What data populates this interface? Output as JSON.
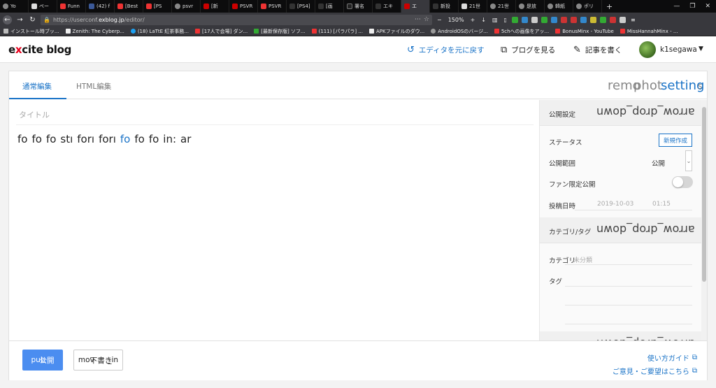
{
  "browser": {
    "tabs": [
      {
        "label": "Yo",
        "fav": "grey"
      },
      {
        "label": "ペー",
        "fav": "white"
      },
      {
        "label": "Funn",
        "fav": ""
      },
      {
        "label": "(42) f",
        "fav": "blue"
      },
      {
        "label": "[Best",
        "fav": ""
      },
      {
        "label": "[PS",
        "fav": ""
      },
      {
        "label": "psvr",
        "fav": "grey"
      },
      {
        "label": "[新",
        "fav": "red2"
      },
      {
        "label": "PSVR",
        "fav": "red2"
      },
      {
        "label": "PSVR",
        "fav": ""
      },
      {
        "label": "[PS4] ",
        "fav": "dark"
      },
      {
        "label": "[画",
        "fav": "dark"
      },
      {
        "label": "署名",
        "fav": "black"
      },
      {
        "label": "エキ",
        "fav": "dark"
      },
      {
        "label": "エ",
        "fav": "red2",
        "active": true
      },
      {
        "label": "新投",
        "fav": "dark"
      },
      {
        "label": "21世",
        "fav": "white"
      },
      {
        "label": "21世",
        "fav": "grey"
      },
      {
        "label": "是放",
        "fav": "grey"
      },
      {
        "label": "韓紙",
        "fav": "grey"
      },
      {
        "label": "ポリ",
        "fav": "grey"
      }
    ],
    "url_prefix": "https://userconf.",
    "url_host": "exblog.jp",
    "url_path": "/editor/",
    "zoom": "150%",
    "bookmarks": [
      {
        "label": "インストール時ブッ...",
        "fav": "folder"
      },
      {
        "label": "Zenith: The Cyberp...",
        "fav": "wht"
      },
      {
        "label": "(18) LaTtE 紅茶事務...",
        "fav": "tw"
      },
      {
        "label": "[17人で会場] ダン...",
        "fav": ""
      },
      {
        "label": "[最新保存版] ソフ...",
        "fav": "grn"
      },
      {
        "label": "(111) [パラパラ] ...",
        "fav": ""
      },
      {
        "label": "APKファイルのダウ...",
        "fav": "wht"
      },
      {
        "label": "AndroidOSのバージ...",
        "fav": "gry"
      },
      {
        "label": "5chへの画像をアッ...",
        "fav": ""
      },
      {
        "label": "BonusMinx - YouTube",
        "fav": ""
      },
      {
        "label": "MissHannahMinx - ...",
        "fav": ""
      }
    ]
  },
  "header": {
    "logo_prefix": "e",
    "logo_mark": "x",
    "logo_suffix": "cite blog",
    "revert_label": "エディタを元に戻す",
    "view_blog_label": "ブログを見る",
    "write_label": "記事を書く",
    "username": "k1segawa"
  },
  "editor": {
    "tab_normal": "通常編集",
    "tab_html": "HTML編集",
    "overlay_remove": "remo",
    "overlay_photo": "phot",
    "overlay_settings": "setting",
    "overlay_settings_tail": "s",
    "title_placeholder": "タイトル",
    "toolbar_tokens": [
      "fo",
      "fo",
      "fo",
      "stı",
      "forı",
      "forı",
      "fo",
      "fo",
      "fo",
      "in:",
      "ar"
    ],
    "toolbar_highlight_index": 6
  },
  "sidebar": {
    "publish_section": "公開設定",
    "arrow_text": "arrow_drop_down",
    "status_label": "ステータス",
    "new_button": "新規作成",
    "scope_label": "公開範囲",
    "scope_value": "公開",
    "fan_label": "ファン限定公開",
    "date_label": "投稿日時",
    "date_value": "2019-10-03",
    "time_value": "01:15",
    "category_section": "カテゴリ/タグ",
    "category_label": "カテゴリ",
    "category_value": "未分類",
    "tag_label": "タグ"
  },
  "footer": {
    "publish_button": "pub",
    "publish_button_jp": "公開",
    "draft_button": "mov",
    "draft_button_jp": "下書き",
    "draft_button_tail": "_in",
    "guide_link": "使い方ガイド",
    "feedback_link": "ご意見・ご要望はこちら"
  },
  "colors": {
    "accent": "#1a73c7",
    "brand_red": "#e8001d",
    "publish_blue": "#4b8df0"
  }
}
